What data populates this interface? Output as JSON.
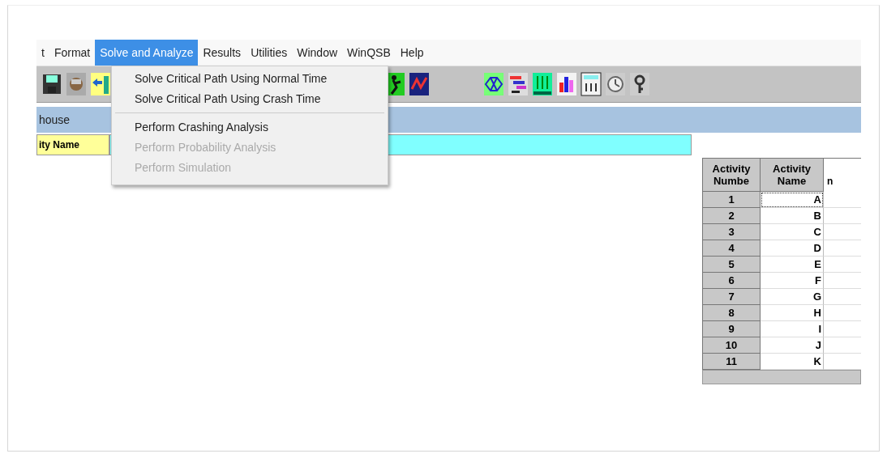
{
  "menu_bar": [
    {
      "label": "t",
      "selected": false
    },
    {
      "label": "Format",
      "selected": false
    },
    {
      "label": "Solve and Analyze",
      "selected": true
    },
    {
      "label": "Results",
      "selected": false
    },
    {
      "label": "Utilities",
      "selected": false
    },
    {
      "label": "Window",
      "selected": false
    },
    {
      "label": "WinQSB",
      "selected": false
    },
    {
      "label": "Help",
      "selected": false
    }
  ],
  "dropdown": [
    {
      "kind": "item",
      "label": "Solve Critical Path Using Normal Time",
      "disabled": false
    },
    {
      "kind": "item",
      "label": "Solve Critical Path Using Crash Time",
      "disabled": false
    },
    {
      "kind": "separator"
    },
    {
      "kind": "item",
      "label": "Perform Crashing Analysis",
      "disabled": false
    },
    {
      "kind": "item",
      "label": "Perform Probability Analysis",
      "disabled": true
    },
    {
      "kind": "item",
      "label": "Perform Simulation",
      "disabled": true
    }
  ],
  "caption": "house",
  "name_cell": "ity Name",
  "table": {
    "columns": [
      "Activity Numbe",
      "Activity Name",
      "n"
    ],
    "rows": [
      {
        "number": "1",
        "name": "A",
        "focused": true
      },
      {
        "number": "2",
        "name": "B",
        "focused": false
      },
      {
        "number": "3",
        "name": "C",
        "focused": false
      },
      {
        "number": "4",
        "name": "D",
        "focused": false
      },
      {
        "number": "5",
        "name": "E",
        "focused": false
      },
      {
        "number": "6",
        "name": "F",
        "focused": false
      },
      {
        "number": "7",
        "name": "G",
        "focused": false
      },
      {
        "number": "8",
        "name": "H",
        "focused": false
      },
      {
        "number": "9",
        "name": "I",
        "focused": false
      },
      {
        "number": "10",
        "name": "J",
        "focused": false
      },
      {
        "number": "11",
        "name": "K",
        "focused": false
      }
    ]
  }
}
